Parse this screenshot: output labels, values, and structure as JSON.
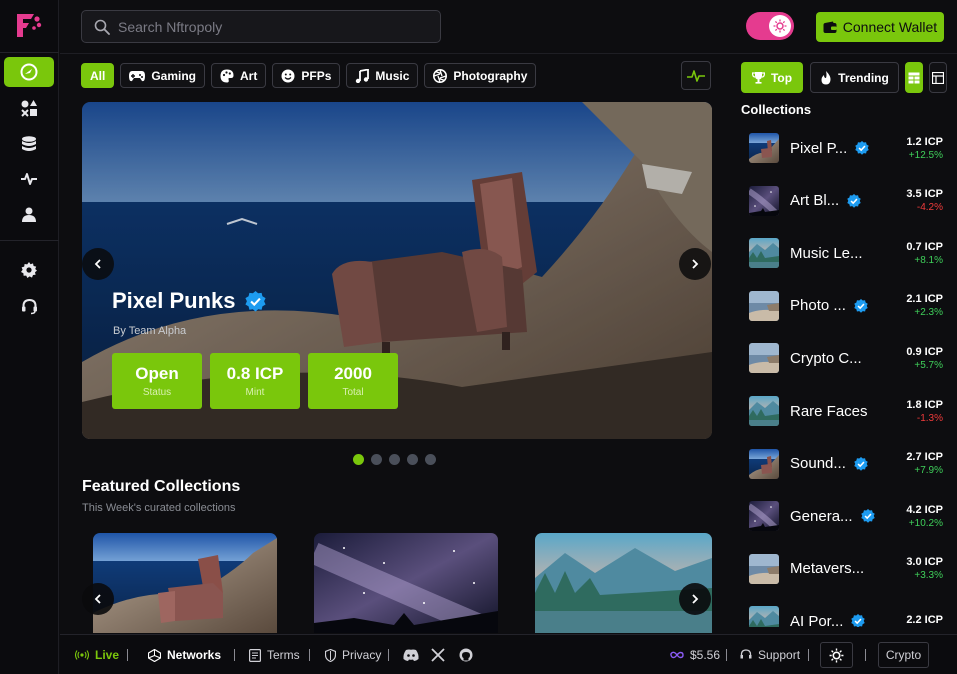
{
  "search": {
    "placeholder": "Search Nftropoly"
  },
  "header": {
    "connect_label": "Connect Wallet"
  },
  "categories": [
    {
      "label": "All",
      "icon": "none"
    },
    {
      "label": "Gaming",
      "icon": "gamepad-icon"
    },
    {
      "label": "Art",
      "icon": "palette-icon"
    },
    {
      "label": "PFPs",
      "icon": "smiley-icon"
    },
    {
      "label": "Music",
      "icon": "music-icon"
    },
    {
      "label": "Photography",
      "icon": "aperture-icon"
    }
  ],
  "hero": {
    "title": "Pixel Punks",
    "by": "By Team Alpha",
    "stats": [
      {
        "value": "Open",
        "label": "Status"
      },
      {
        "value": "0.8 ICP",
        "label": "Mint"
      },
      {
        "value": "2000",
        "label": "Total"
      }
    ],
    "slide_count": 5,
    "active_slide": 1
  },
  "featured": {
    "title": "Featured Collections",
    "subtitle": "This Week's curated collections"
  },
  "right_panel": {
    "top_label": "Top",
    "trending_label": "Trending",
    "collections_title": "Collections",
    "items": [
      {
        "name": "Pixel P...",
        "verified": true,
        "price": "1.2 ICP",
        "change": "+12.5%",
        "dir": "pos",
        "thumb": "chair"
      },
      {
        "name": "Art Bl...",
        "verified": true,
        "price": "3.5 ICP",
        "change": "-4.2%",
        "dir": "neg",
        "thumb": "stars"
      },
      {
        "name": "Music Le...",
        "verified": false,
        "price": "0.7 ICP",
        "change": "+8.1%",
        "dir": "pos",
        "thumb": "lake"
      },
      {
        "name": "Photo ...",
        "verified": true,
        "price": "2.1 ICP",
        "change": "+2.3%",
        "dir": "pos",
        "thumb": "coast"
      },
      {
        "name": "Crypto C...",
        "verified": false,
        "price": "0.9 ICP",
        "change": "+5.7%",
        "dir": "pos",
        "thumb": "coast"
      },
      {
        "name": "Rare Faces",
        "verified": false,
        "price": "1.8 ICP",
        "change": "-1.3%",
        "dir": "neg",
        "thumb": "lake"
      },
      {
        "name": "Sound...",
        "verified": true,
        "price": "2.7 ICP",
        "change": "+7.9%",
        "dir": "pos",
        "thumb": "chair"
      },
      {
        "name": "Genera...",
        "verified": true,
        "price": "4.2 ICP",
        "change": "+10.2%",
        "dir": "pos",
        "thumb": "stars"
      },
      {
        "name": "Metavers...",
        "verified": false,
        "price": "3.0 ICP",
        "change": "+3.3%",
        "dir": "pos",
        "thumb": "coast"
      },
      {
        "name": "AI Por...",
        "verified": true,
        "price": "2.2 ICP",
        "change": "",
        "dir": "pos",
        "thumb": "lake"
      }
    ]
  },
  "footer": {
    "live_label": "Live",
    "networks_label": "Networks",
    "terms_label": "Terms",
    "privacy_label": "Privacy",
    "price_label": "$5.56",
    "support_label": "Support",
    "crypto_label": "Crypto"
  },
  "colors": {
    "accent": "#7ac70c",
    "toggle": "#e53b8f",
    "verified": "#1d9bf0",
    "negative": "#ef3b3b",
    "positive": "#3fcf5a"
  }
}
